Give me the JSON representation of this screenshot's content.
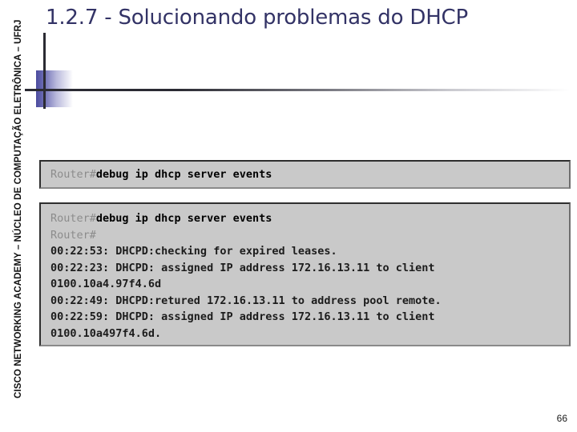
{
  "sidebar": {
    "label": "CISCO NETWORKING ACADEMY – NÚCLEO DE COMPUTAÇÃO ELETRÔNICA – UFRJ"
  },
  "title": {
    "text": "1.2.7 - Solucionando problemas do DHCP",
    "color": "#333366"
  },
  "decoration": {
    "accent_color": "#4b4b9e",
    "line_color": "#2b2b33"
  },
  "terminal_command_box": {
    "prompt": "Router#",
    "command": "debug ip dhcp server events"
  },
  "terminal_output_box": {
    "lines": [
      {
        "prompt": "Router#",
        "command": "debug ip dhcp server events",
        "output": ""
      },
      {
        "prompt": "Router#",
        "command": "",
        "output": ""
      },
      {
        "prompt": "",
        "command": "",
        "output": "00:22:53: DHCPD:checking for expired leases."
      },
      {
        "prompt": "",
        "command": "",
        "output": "00:22:23: DHCPD: assigned IP address 172.16.13.11 to client"
      },
      {
        "prompt": "",
        "command": "",
        "output": "0100.10a4.97f4.6d"
      },
      {
        "prompt": "",
        "command": "",
        "output": "00:22:49: DHCPD:retured 172.16.13.11 to address pool remote."
      },
      {
        "prompt": "",
        "command": "",
        "output": "00:22:59: DHCPD: assigned IP address 172.16.13.11 to client"
      },
      {
        "prompt": "",
        "command": "",
        "output": "0100.10a497f4.6d."
      }
    ]
  },
  "footer": {
    "page_number": "66"
  }
}
